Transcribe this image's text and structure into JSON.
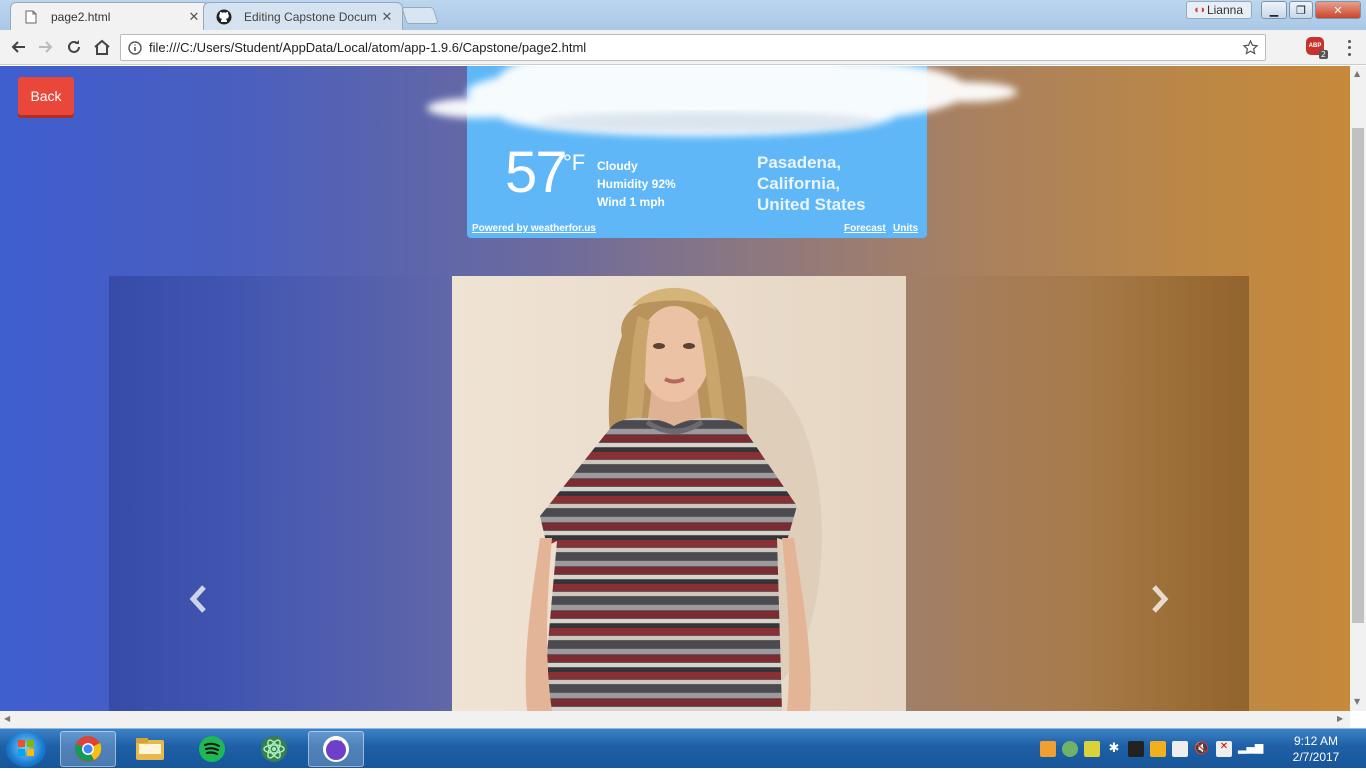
{
  "browser": {
    "tabs": [
      {
        "label": "page2.html",
        "icon": "file-icon",
        "active": true
      },
      {
        "label": "Editing Capstone Docum",
        "icon": "github-icon",
        "active": false
      }
    ],
    "profile_name": "Lianna",
    "url": "file:///C:/Users/Student/AppData/Local/atom/app-1.9.6/Capstone/page2.html",
    "adblock_count": "2",
    "adblock_label": "ABP"
  },
  "page": {
    "back_label": "Back",
    "weather": {
      "temperature": "57",
      "unit": "°F",
      "condition": "Cloudy",
      "humidity": "Humidity 92%",
      "wind": "Wind 1 mph",
      "location_line1": "Pasadena, California,",
      "location_line2": "United States",
      "powered_by": "Powered by weatherfor.us",
      "forecast_link": "Forecast",
      "units_link": "Units"
    },
    "carousel": {
      "prev_icon": "chevron-left-icon",
      "next_icon": "chevron-right-icon",
      "slide_image": "striped-dress-model"
    }
  },
  "taskbar": {
    "apps": [
      "chrome-icon",
      "file-explorer-icon",
      "spotify-icon",
      "atom-icon",
      "github-desktop-icon"
    ],
    "time": "9:12 AM",
    "date": "2/7/2017"
  },
  "colors": {
    "back_button": "#e8473a",
    "weather_bg": "#5fb7f7",
    "page_gradient_left": "#3f5ecf",
    "page_gradient_right": "#c7893a"
  }
}
